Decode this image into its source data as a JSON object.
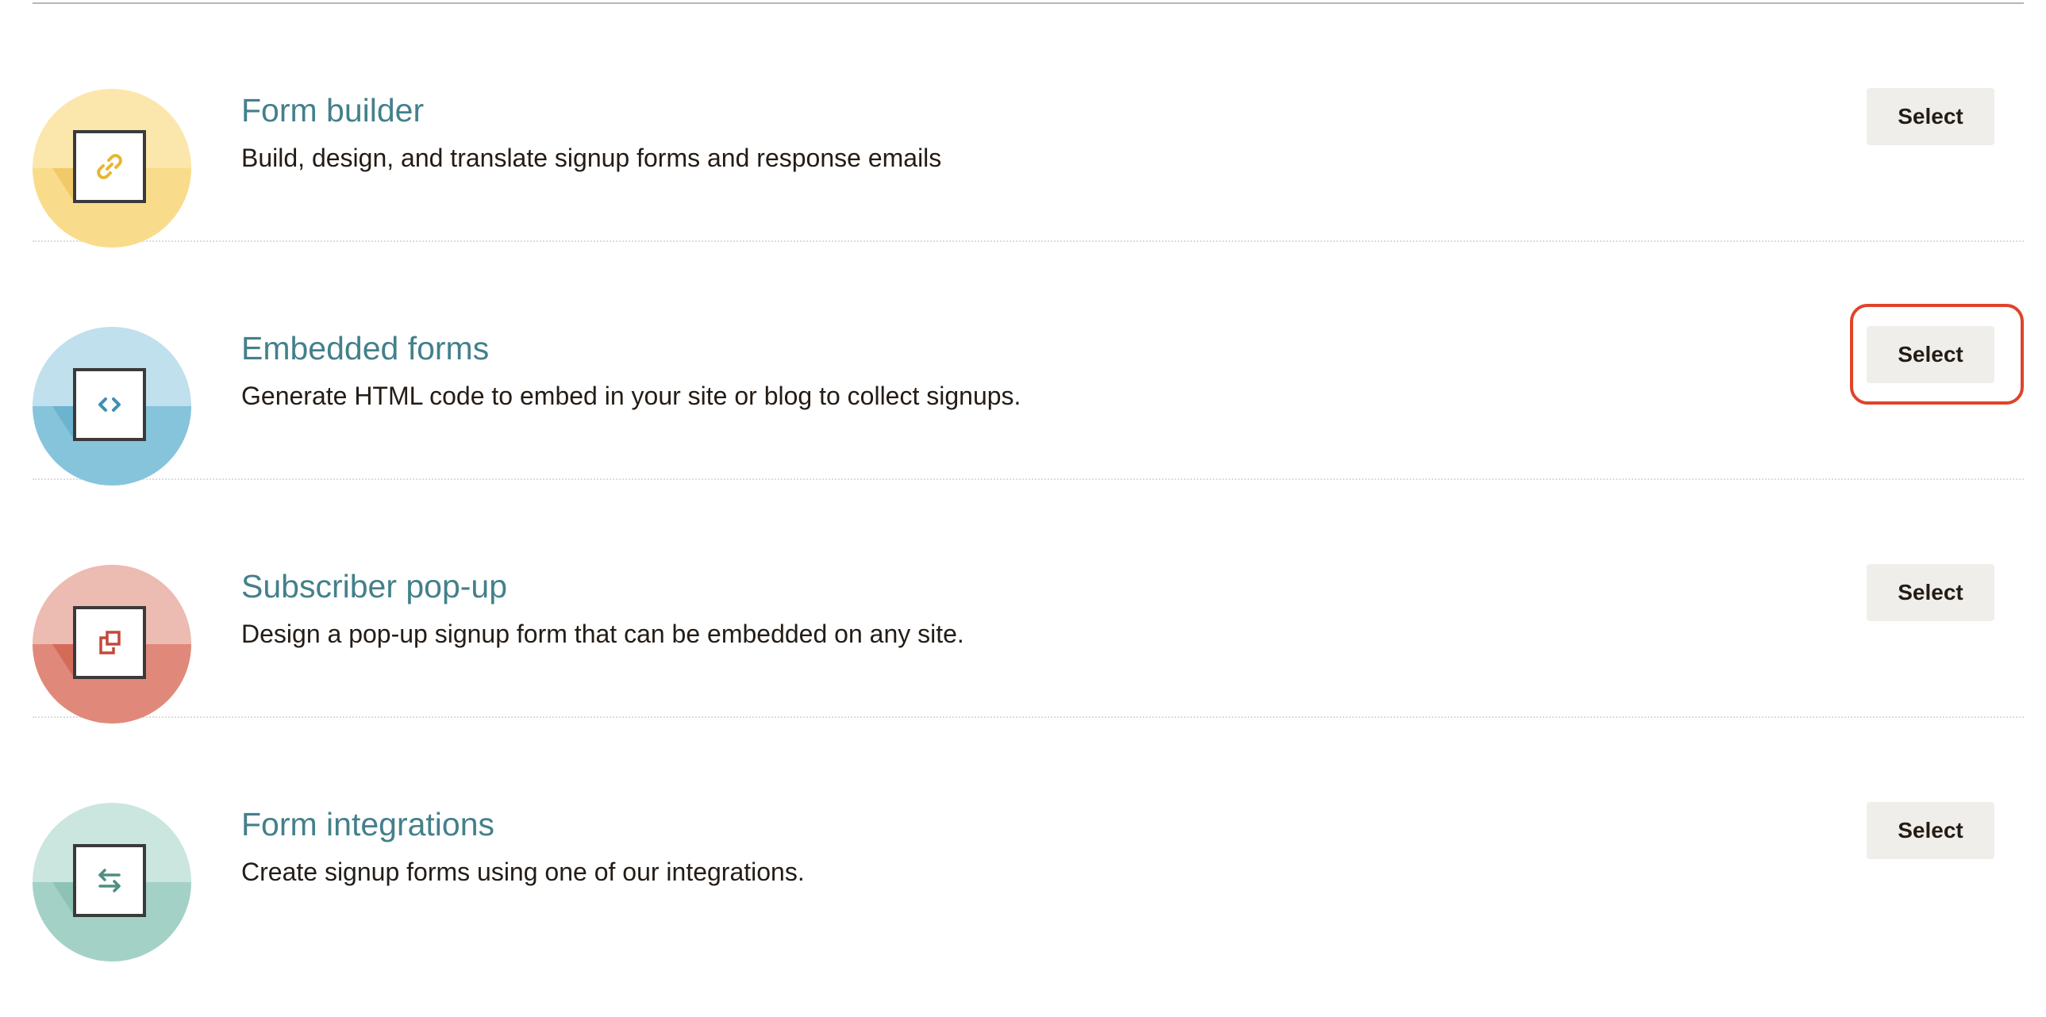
{
  "options": [
    {
      "title": "Form builder",
      "description": "Build, design, and translate signup forms and response emails",
      "button_label": "Select",
      "icon": "link-icon",
      "colors": {
        "light": "#fbe6ac",
        "dark": "#f9dc8b",
        "glyph": "#e8b632"
      },
      "highlighted": false
    },
    {
      "title": "Embedded forms",
      "description": "Generate HTML code to embed in your site or blog to collect signups.",
      "button_label": "Select",
      "icon": "code-icon",
      "colors": {
        "light": "#bfe0ec",
        "dark": "#86c4dc",
        "glyph": "#3f8fb0"
      },
      "highlighted": true
    },
    {
      "title": "Subscriber pop-up",
      "description": "Design a pop-up signup form that can be embedded on any site.",
      "button_label": "Select",
      "icon": "popup-icon",
      "colors": {
        "light": "#ecbbb1",
        "dark": "#e0897a",
        "glyph": "#c2493a"
      },
      "highlighted": false
    },
    {
      "title": "Form integrations",
      "description": "Create signup forms using one of our integrations.",
      "button_label": "Select",
      "icon": "swap-arrows-icon",
      "colors": {
        "light": "#cbe5df",
        "dark": "#a4d1c6",
        "glyph": "#4e8f80"
      },
      "highlighted": false
    }
  ],
  "highlight_color": "#e0432a"
}
